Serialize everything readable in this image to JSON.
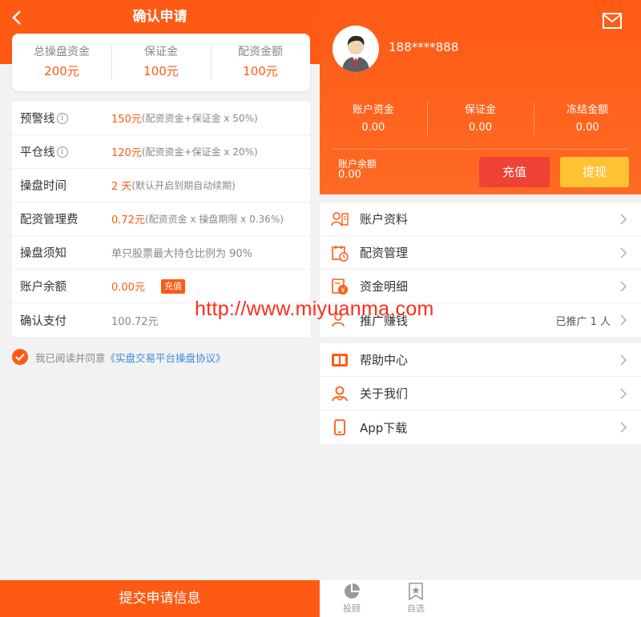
{
  "left": {
    "title": "确认申请",
    "summary": [
      {
        "label": "总操盘资金",
        "value": "200元"
      },
      {
        "label": "保证金",
        "value": "100元"
      },
      {
        "label": "配资金额",
        "value": "100元"
      }
    ],
    "rows": {
      "warning": {
        "label": "预警线",
        "value": "150元",
        "note": "(配资资金+保证金 x 50%)"
      },
      "liquidation": {
        "label": "平仓线",
        "value": "120元",
        "note": "(配资资金+保证金 x 20%)"
      },
      "duration": {
        "label": "操盘时间",
        "value": "2 天",
        "note": "(默认开启到期自动续期)"
      },
      "fee": {
        "label": "配资管理费",
        "value": "0.72元",
        "note": "(配资资金 x 操盘期限 x 0.36%)"
      },
      "notice": {
        "label": "操盘须知",
        "value": "单只股票最大持仓比例为 90%"
      },
      "balance": {
        "label": "账户余额",
        "value": "0.00元",
        "tag": "充值"
      },
      "payment": {
        "label": "确认支付",
        "value": "100.72元"
      }
    },
    "agree_text": "我已阅读并同意",
    "agree_link": "《实盘交易平台操盘协议》",
    "submit_label": "提交申请信息"
  },
  "right": {
    "phone": "188****888",
    "stats": [
      {
        "label": "账户资金",
        "value": "0.00"
      },
      {
        "label": "保证金",
        "value": "0.00"
      },
      {
        "label": "冻结金额",
        "value": "0.00"
      }
    ],
    "balance_label": "账户余额",
    "balance_value": "0.00",
    "recharge_label": "充值",
    "withdraw_label": "提现",
    "menu1": [
      {
        "label": "账户资料",
        "icon": "profile-icon"
      },
      {
        "label": "配资管理",
        "icon": "calendar-icon"
      },
      {
        "label": "资金明细",
        "icon": "money-icon"
      },
      {
        "label": "推广赚钱",
        "icon": "promote-icon",
        "extra": "已推广 1 人"
      }
    ],
    "menu2": [
      {
        "label": "帮助中心",
        "icon": "book-icon"
      },
      {
        "label": "关于我们",
        "icon": "people-icon"
      },
      {
        "label": "App下载",
        "icon": "phone-icon"
      }
    ],
    "nav": [
      {
        "label": "投顾",
        "icon": "pie-icon"
      },
      {
        "label": "自选",
        "icon": "bookmark-star-icon"
      }
    ]
  },
  "watermark": "http://www.miyuanma.com",
  "colors": {
    "brand": "#ff5a14",
    "recharge": "#ef4234",
    "withdraw": "#ffc233",
    "link": "#3a8ddc"
  }
}
